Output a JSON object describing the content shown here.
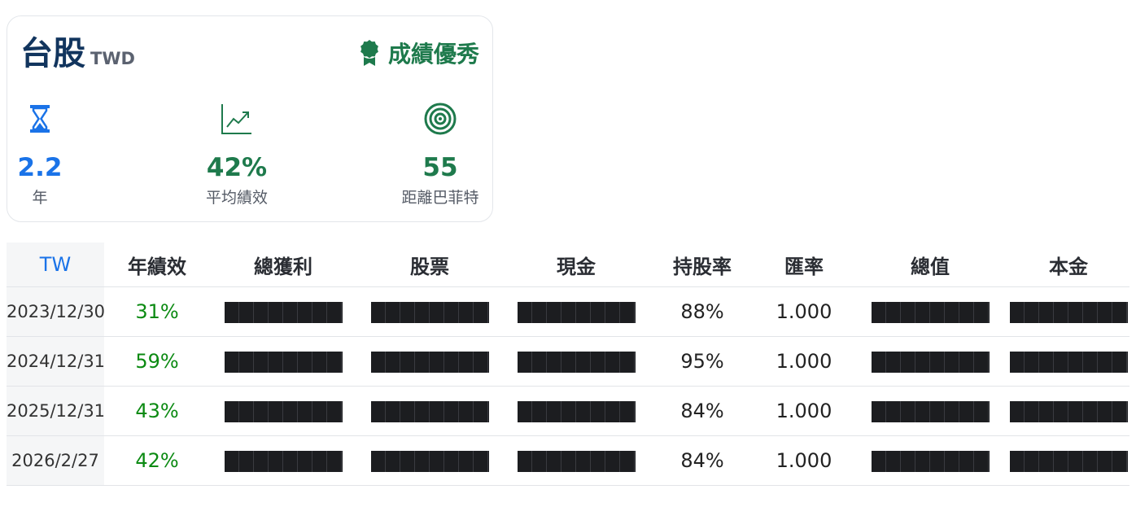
{
  "card": {
    "title": "台股",
    "currency": "TWD",
    "badge": {
      "icon": "award-ribbon-icon",
      "label": "成績優秀"
    },
    "stats": [
      {
        "icon": "hourglass-icon",
        "value": "2.2",
        "label": "年"
      },
      {
        "icon": "trend-chart-icon",
        "value": "42%",
        "label": "平均績效"
      },
      {
        "icon": "target-icon",
        "value": "55",
        "label": "距離巴菲特"
      }
    ]
  },
  "colors": {
    "accent_blue": "#1a73e8",
    "accent_green": "#1e7a4c",
    "positive": "#0b8a12"
  },
  "table": {
    "headers": [
      "TW",
      "年績效",
      "總獲利",
      "股票",
      "現金",
      "持股率",
      "匯率",
      "總值",
      "本金"
    ],
    "rows": [
      {
        "date": "2023/12/30",
        "return": "31%",
        "holding": "88%",
        "fx": "1.000"
      },
      {
        "date": "2024/12/31",
        "return": "59%",
        "holding": "95%",
        "fx": "1.000"
      },
      {
        "date": "2025/12/31",
        "return": "43%",
        "holding": "84%",
        "fx": "1.000"
      },
      {
        "date": "2026/2/27",
        "return": "42%",
        "holding": "84%",
        "fx": "1.000"
      }
    ]
  }
}
